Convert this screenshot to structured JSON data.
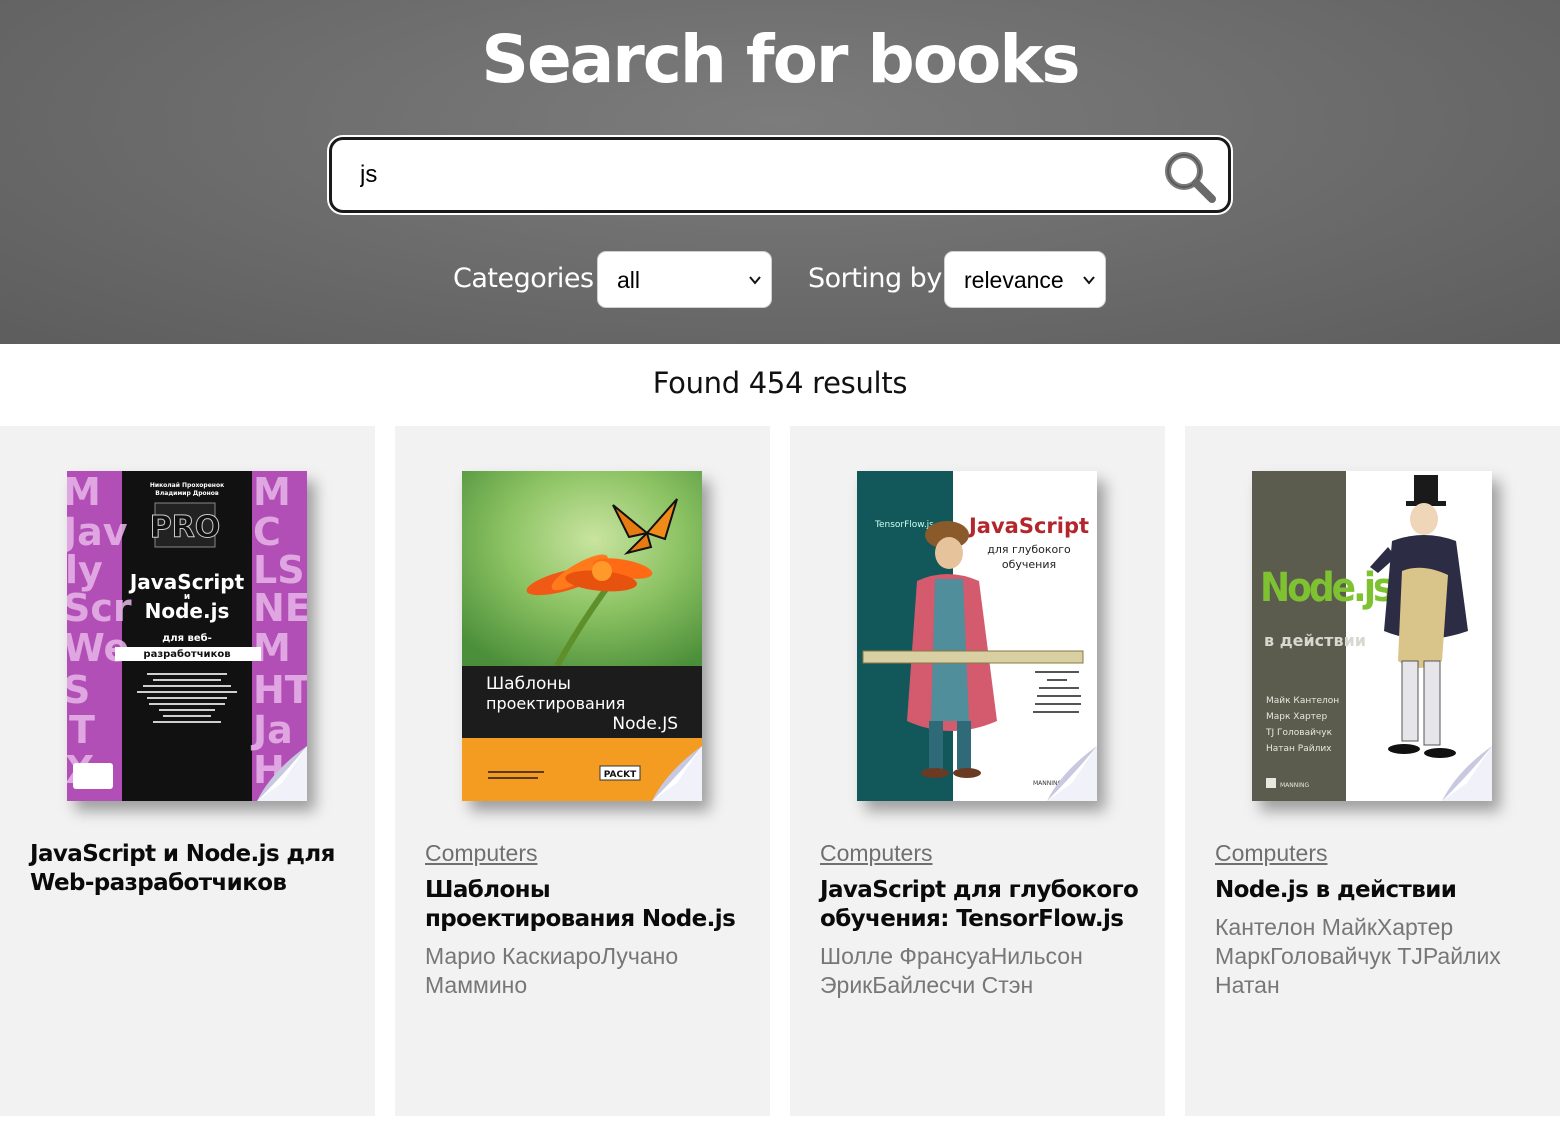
{
  "header": {
    "title": "Search for books",
    "search": {
      "value": "js",
      "placeholder": ""
    },
    "categories_label": "Categories",
    "categories_selected": "all",
    "sorting_label": "Sorting by",
    "sorting_selected": "relevance"
  },
  "results": {
    "summary": "Found 454 results",
    "books": [
      {
        "category": "",
        "title": "JavaScript и Node.js для Web-разработчиков",
        "authors": "",
        "cover": {
          "author_line_1": "Николай Прохоренок",
          "author_line_2": "Владимир Дронов",
          "badge": "PRO",
          "title_1": "JavaScript",
          "title_2": "и",
          "title_3": "Node.js",
          "subtitle_1": "для веб-",
          "subtitle_2": "разработчиков"
        }
      },
      {
        "category": "Computers",
        "title": "Шаблоны проектирования Node.js",
        "authors": "Марио КаскиароЛучано Маммино",
        "cover": {
          "title_1": "Шаблоны",
          "title_2": "проектирования",
          "title_3": "Node.JS",
          "publisher": "PACKT"
        }
      },
      {
        "category": "Computers",
        "title": "JavaScript для глубокого обучения: TensorFlow.js",
        "authors": "Шолле ФрансуаНильсон ЭрикБайлесчи Стэн",
        "cover": {
          "tag": "TensorFlow.js",
          "title_1": "JavaScript",
          "title_2": "для глубокого",
          "title_3": "обучения",
          "publisher": "MANNING"
        }
      },
      {
        "category": "Computers",
        "title": "Node.js в действии",
        "authors": "Кантелон МайкХартер МаркГоловайчук TJРайлих Натан",
        "cover": {
          "title_1": "Node.js",
          "title_2": "в действии",
          "author_1": "Майк Кантелон",
          "author_2": "Марк Хартер",
          "author_3": "TJ Головайчук",
          "author_4": "Натан Райлих",
          "publisher": "MANNING"
        }
      }
    ]
  },
  "colors": {
    "header_bg": "#6e6e6e",
    "card_bg": "#f2f2f2",
    "node_green": "#7ec232",
    "packt_orange": "#f39c21",
    "pink_accent": "#c453c8"
  },
  "icons": {
    "search": "magnifier-icon",
    "chevron": "chevron-down-icon"
  }
}
